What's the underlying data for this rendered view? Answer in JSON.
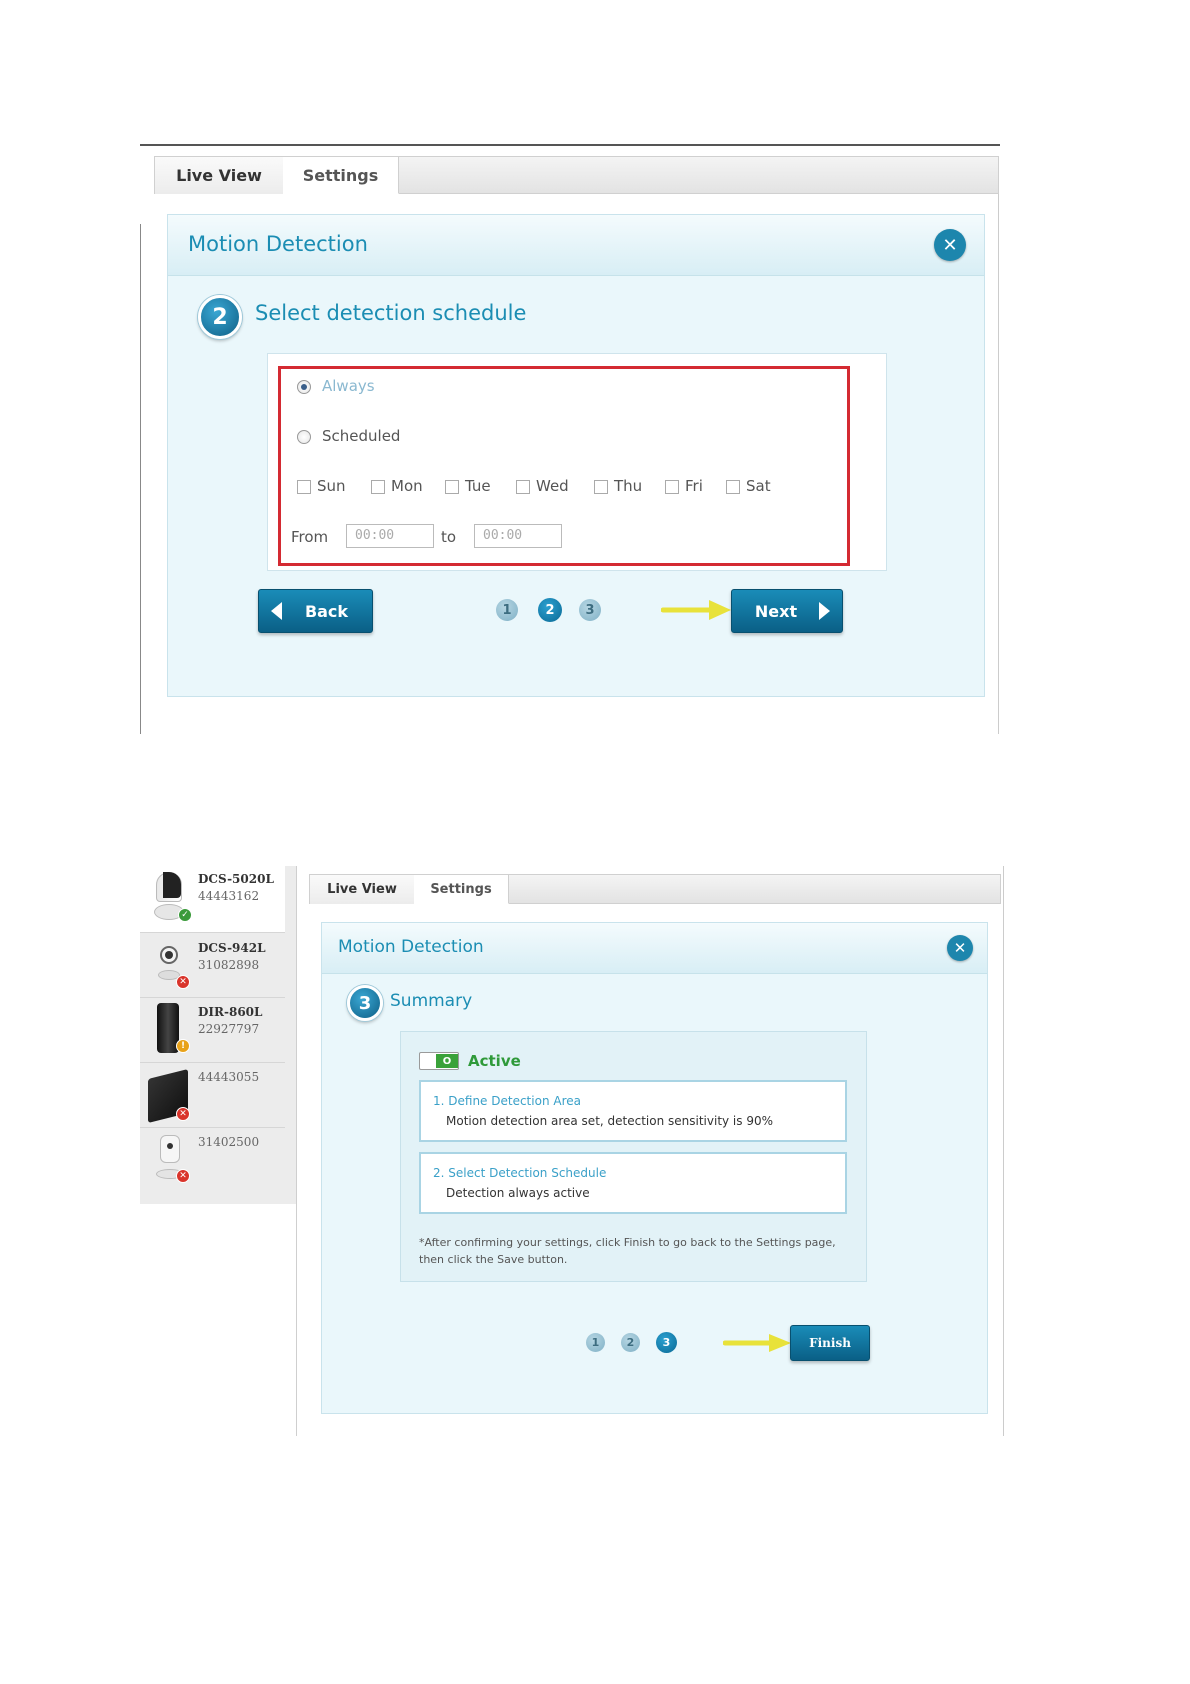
{
  "panel1": {
    "tabs": [
      {
        "label": "Live View"
      },
      {
        "label": "Settings"
      }
    ],
    "dialog_title": "Motion Detection",
    "step": {
      "number": "2",
      "title": "Select detection schedule"
    },
    "schedule": {
      "always_label": "Always",
      "scheduled_label": "Scheduled",
      "days": [
        "Sun",
        "Mon",
        "Tue",
        "Wed",
        "Thu",
        "Fri",
        "Sat"
      ],
      "from_label": "From",
      "from_value": "00:00",
      "to_label": "to",
      "to_value": "00:00"
    },
    "back_label": "Back",
    "next_label": "Next",
    "pager": [
      "1",
      "2",
      "3"
    ],
    "current_page": 2
  },
  "panel2": {
    "devices": [
      {
        "name": "DCS-5020L",
        "id": "44443162",
        "status": "ok"
      },
      {
        "name": "DCS-942L",
        "id": "31082898",
        "status": "error"
      },
      {
        "name": "DIR-860L",
        "id": "22927797",
        "status": "warning"
      },
      {
        "name": "",
        "id": "44443055",
        "status": "error"
      },
      {
        "name": "",
        "id": "31402500",
        "status": "error"
      }
    ],
    "tabs": [
      {
        "label": "Live View"
      },
      {
        "label": "Settings"
      }
    ],
    "dialog_title": "Motion Detection",
    "step": {
      "number": "3",
      "title": "Summary"
    },
    "toggle_value": "O",
    "active_label": "Active",
    "summary": [
      {
        "heading": "1. Define Detection Area",
        "text": "Motion detection area set, detection sensitivity is 90%"
      },
      {
        "heading": "2. Select Detection Schedule",
        "text": "Detection always active"
      }
    ],
    "note": "*After confirming your settings, click Finish to go back to the Settings page, then click the Save button.",
    "finish_label": "Finish",
    "pager": [
      "1",
      "2",
      "3"
    ],
    "current_page": 3
  }
}
